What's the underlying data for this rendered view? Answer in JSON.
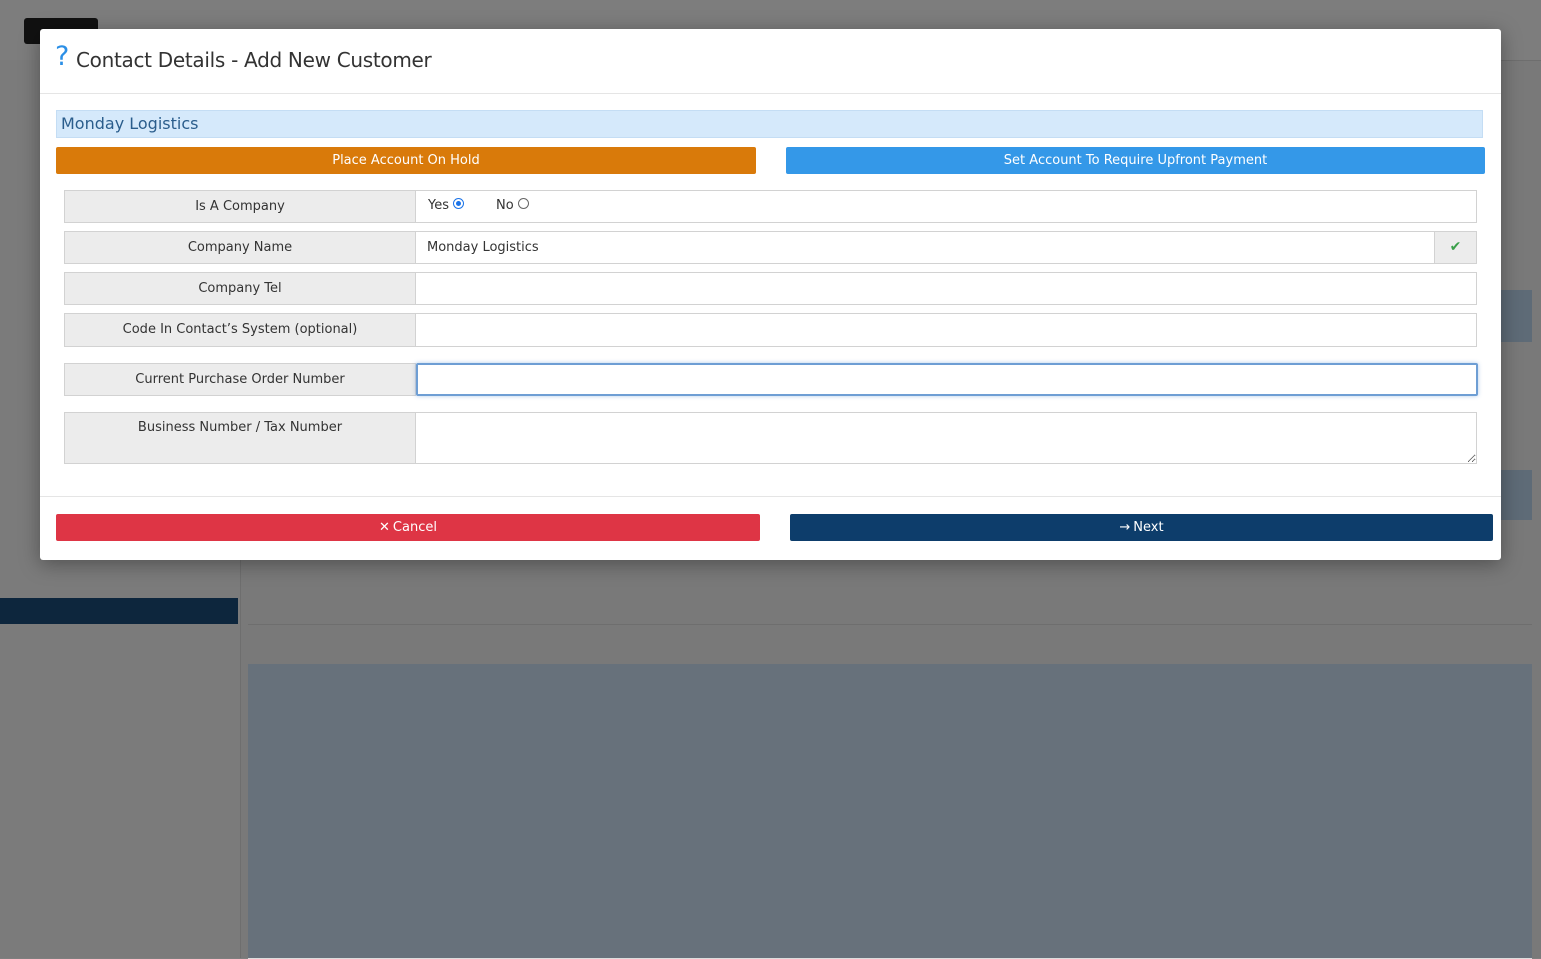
{
  "modal": {
    "help_icon": "?",
    "title": "Contact Details - Add New Customer",
    "company_banner": "Monday Logistics",
    "hold_button": "Place Account On Hold",
    "upfront_button": "Set Account To Require Upfront Payment",
    "fields": {
      "is_company": {
        "label": "Is A Company",
        "yes_label": "Yes",
        "no_label": "No",
        "selected": "Yes"
      },
      "company_name": {
        "label": "Company Name",
        "value": "Monday Logistics",
        "check_icon": "✔"
      },
      "company_tel": {
        "label": "Company Tel",
        "value": ""
      },
      "code_in_system": {
        "label": "Code In Contact’s System (optional)",
        "value": ""
      },
      "purchase_order": {
        "label": "Current Purchase Order Number",
        "value": ""
      },
      "business_number": {
        "label": "Business Number / Tax Number",
        "value": ""
      }
    },
    "cancel_icon": "✕",
    "cancel_label": "Cancel",
    "next_icon": "→",
    "next_label": "Next"
  },
  "colors": {
    "hold": "#d97a0a",
    "upfront": "#3498e8",
    "cancel": "#de3545",
    "next": "#0d3d6b",
    "banner": "#d5e9fb"
  }
}
